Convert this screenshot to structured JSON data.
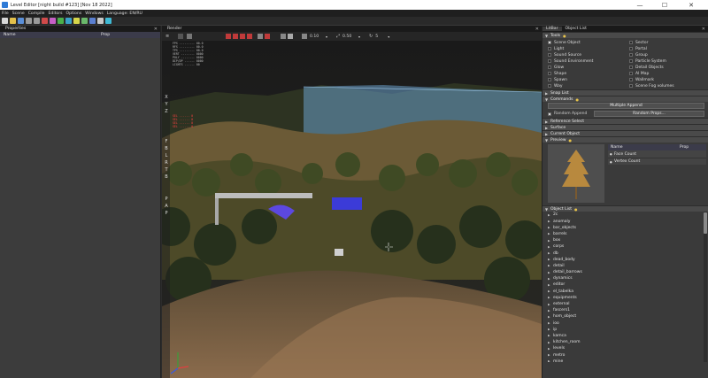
{
  "window": {
    "title": "Level Editor [night build #123] [Nov 18 2022]",
    "controls": [
      "—",
      "☐",
      "✕"
    ]
  },
  "menu": [
    "File",
    "Scene",
    "Compile",
    "Editors",
    "Options",
    "Windows",
    "Language: EN/RU"
  ],
  "properties": {
    "title": "Properties",
    "col_name": "Name",
    "col_prop": "Prop"
  },
  "render": {
    "title": "Render",
    "toolbar": {
      "grid_value": "0.10",
      "move_value": "0.50",
      "rot_value": "5"
    },
    "side_letters_top": [
      "X",
      "Y",
      "Z"
    ],
    "side_letters_mid": [
      "F",
      "B",
      "L",
      "R",
      "T",
      "B"
    ],
    "side_letters_bottom": [
      "P",
      "A",
      "P"
    ]
  },
  "right": {
    "tabs": [
      "LitBar",
      "Object List"
    ],
    "tools_header": "Tools",
    "tools": [
      {
        "label": "Scene Object",
        "on": true
      },
      {
        "label": "Sector",
        "on": false
      },
      {
        "label": "Light",
        "on": false
      },
      {
        "label": "Portal",
        "on": false
      },
      {
        "label": "Sound Source",
        "on": false
      },
      {
        "label": "Group",
        "on": false
      },
      {
        "label": "Sound Environment",
        "on": false
      },
      {
        "label": "Particle System",
        "on": false
      },
      {
        "label": "Glow",
        "on": false
      },
      {
        "label": "Detail Objects",
        "on": false
      },
      {
        "label": "Shape",
        "on": false
      },
      {
        "label": "AI Map",
        "on": false
      },
      {
        "label": "Spawn",
        "on": false
      },
      {
        "label": "Wallmark",
        "on": false
      },
      {
        "label": "Way",
        "on": false
      },
      {
        "label": "Scene Fog volumes",
        "on": false
      }
    ],
    "snap_list": "Snap List",
    "commands": "Commands",
    "multiple_append": "Multiple Append",
    "random_append": "Random Append",
    "random_props": "Random Props...",
    "reference_select": "Reference Select",
    "surface": "Surface",
    "current_object": "Current Object",
    "preview": "Preview",
    "preview_table": {
      "col_name": "Name",
      "col_prop": "Prop",
      "rows": [
        {
          "name": "Face Count",
          "value": ""
        },
        {
          "name": "Vertex Count",
          "value": ""
        }
      ]
    },
    "object_list": "Object List",
    "objects": [
      "2c",
      "anomaly",
      "bar_objects",
      "barrels",
      "box",
      "corps",
      "db",
      "dead_body",
      "detail",
      "detail_barrows",
      "dynamics",
      "editor",
      "el_tabelka",
      "equipments",
      "external",
      "fascers1",
      "hom_object",
      "ioo",
      "ip",
      "kamca",
      "kitchen_room",
      "levels",
      "metro",
      "mine"
    ]
  },
  "colors": {
    "accent": "#e7c34a",
    "header": "#1a1a1a",
    "section": "#4a4a4a"
  }
}
